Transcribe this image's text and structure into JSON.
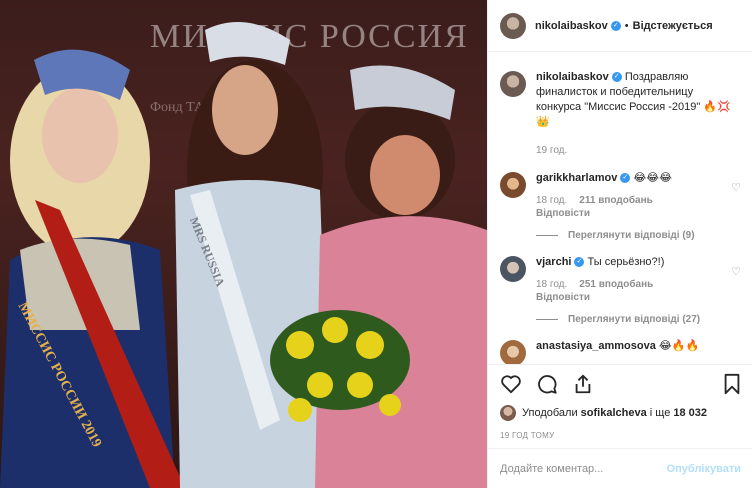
{
  "photo": {
    "banner_text": "МИССИС РОССИЯ",
    "sub_text": "Фонд        ТА Ж",
    "sash_left": "МИССИС РОССИИ 2019",
    "sash_center": "MRS RUSSIA"
  },
  "header": {
    "username": "nikolaibaskov",
    "verified_glyph": "✓",
    "separator": "•",
    "follow_label": "Відстежується"
  },
  "caption": {
    "username": "nikolaibaskov",
    "text": "Поздравляю финалисток и победительницу конкурса \"Миссис Россия -2019\" 🔥💢👑",
    "time": "19 год."
  },
  "comments": [
    {
      "username": "garikkharlamov",
      "text": "😂😂😂",
      "time": "18 год.",
      "likes": "211 вподобань",
      "reply": "Відповісти",
      "view_replies": "Переглянути відповіді (9)"
    },
    {
      "username": "vjarchi",
      "text": "Ты серьёзно?!)",
      "time": "18 год.",
      "likes": "251 вподобань",
      "reply": "Відповісти",
      "view_replies": "Переглянути відповіді (27)"
    },
    {
      "username": "anastasiya_ammosova",
      "text": "😂🔥🔥"
    }
  ],
  "likes": {
    "prefix": "Уподобали",
    "user": "sofikalcheva",
    "middle": "і ще",
    "count": "18 032"
  },
  "post_time": "19 ГОД ТОМУ",
  "add_comment": {
    "placeholder": "Додайте коментар...",
    "post_label": "Опублікувати"
  }
}
